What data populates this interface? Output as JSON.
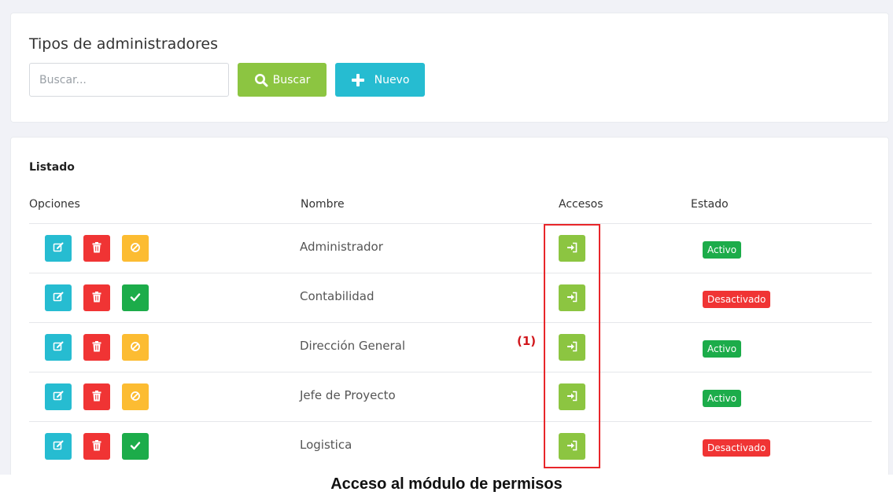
{
  "header": {
    "title": "Tipos de administradores",
    "search_placeholder": "Buscar...",
    "search_value": "",
    "search_button": "Buscar",
    "new_button": "Nuevo"
  },
  "list": {
    "title": "Listado",
    "columns": {
      "options": "Opciones",
      "name": "Nombre",
      "access": "Accesos",
      "status": "Estado"
    },
    "rows": [
      {
        "name": "Administrador",
        "status": "Activo",
        "toggle": "ban"
      },
      {
        "name": "Contabilidad",
        "status": "Desactivado",
        "toggle": "check"
      },
      {
        "name": "Dirección General",
        "status": "Activo",
        "toggle": "ban"
      },
      {
        "name": "Jefe de Proyecto",
        "status": "Activo",
        "toggle": "ban"
      },
      {
        "name": "Logistica",
        "status": "Desactivado",
        "toggle": "check"
      }
    ]
  },
  "annotation": {
    "marker": "(1)",
    "highlight_color": "#e8262a"
  },
  "caption": "Acceso al módulo de permisos",
  "colors": {
    "cyan": "#26bcd1",
    "red": "#f03434",
    "yellow": "#fcbc32",
    "green": "#1cac4a",
    "lime": "#8cc541"
  }
}
